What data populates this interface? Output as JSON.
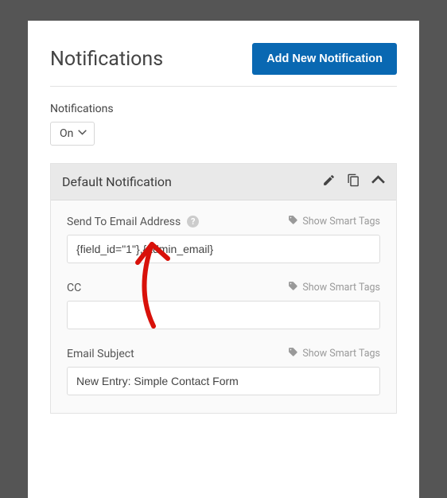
{
  "header": {
    "title": "Notifications",
    "add_button_label": "Add New Notification"
  },
  "toggle": {
    "label": "Notifications",
    "value": "On"
  },
  "panel": {
    "title": "Default Notification",
    "fields": {
      "send_to": {
        "label": "Send To Email Address",
        "smart_tags": "Show Smart Tags",
        "value": "{field_id=\"1\"},{admin_email}"
      },
      "cc": {
        "label": "CC",
        "smart_tags": "Show Smart Tags",
        "value": ""
      },
      "subject": {
        "label": "Email Subject",
        "smart_tags": "Show Smart Tags",
        "value": "New Entry: Simple Contact Form"
      }
    }
  }
}
